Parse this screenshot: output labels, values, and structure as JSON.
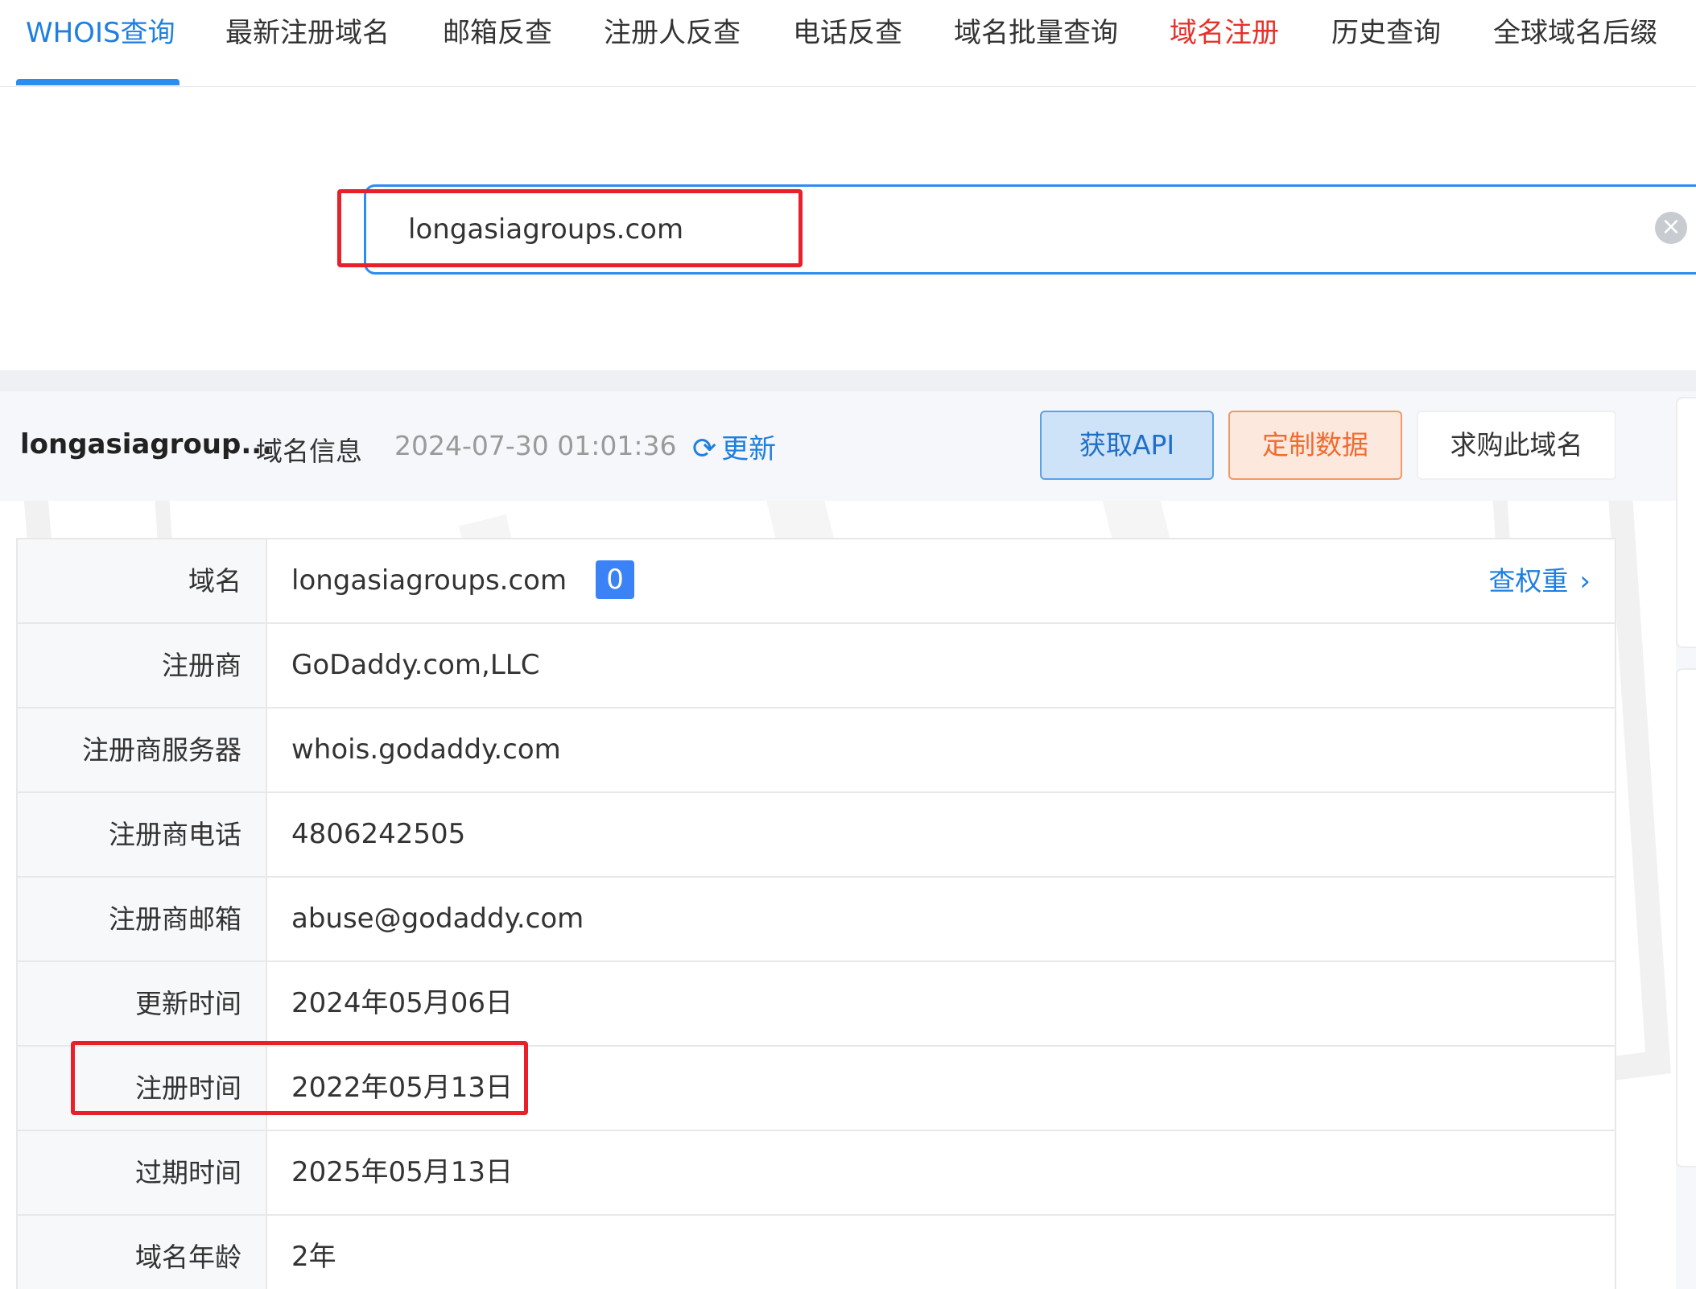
{
  "nav": {
    "items": [
      {
        "label": "WHOIS查询"
      },
      {
        "label": "最新注册域名"
      },
      {
        "label": "邮箱反查"
      },
      {
        "label": "注册人反查"
      },
      {
        "label": "电话反查"
      },
      {
        "label": "域名批量查询"
      },
      {
        "label": "域名注册"
      },
      {
        "label": "历史查询"
      },
      {
        "label": "全球域名后缀"
      }
    ],
    "active_item": "WHOIS查询",
    "highlight_item": "域名注册"
  },
  "search": {
    "value": "longasiagroups.com",
    "clear_icon": "close-circle-icon"
  },
  "info_header": {
    "domain_short": "longasiagroup...",
    "section_label": "域名信息",
    "timestamp": "2024-07-30 01:01:36",
    "refresh_label": "更新",
    "refresh_icon": "refresh-icon",
    "buttons": {
      "api": "获取API",
      "custom": "定制数据",
      "buy": "求购此域名"
    }
  },
  "whois_table": {
    "rows": [
      {
        "label": "域名",
        "value": "longasiagroups.com",
        "badge": "0",
        "link": "查权重"
      },
      {
        "label": "注册商",
        "value": "GoDaddy.com,LLC"
      },
      {
        "label": "注册商服务器",
        "value": "whois.godaddy.com"
      },
      {
        "label": "注册商电话",
        "value": "4806242505"
      },
      {
        "label": "注册商邮箱",
        "value": "abuse@godaddy.com"
      },
      {
        "label": "更新时间",
        "value": "2024年05月06日"
      },
      {
        "label": "注册时间",
        "value": "2022年05月13日"
      },
      {
        "label": "过期时间",
        "value": "2025年05月13日"
      },
      {
        "label": "域名年龄",
        "value": "2年"
      }
    ]
  },
  "colors": {
    "accent": "#2d8cf0",
    "highlight": "#e8302a",
    "annotation": "#e8202a"
  }
}
